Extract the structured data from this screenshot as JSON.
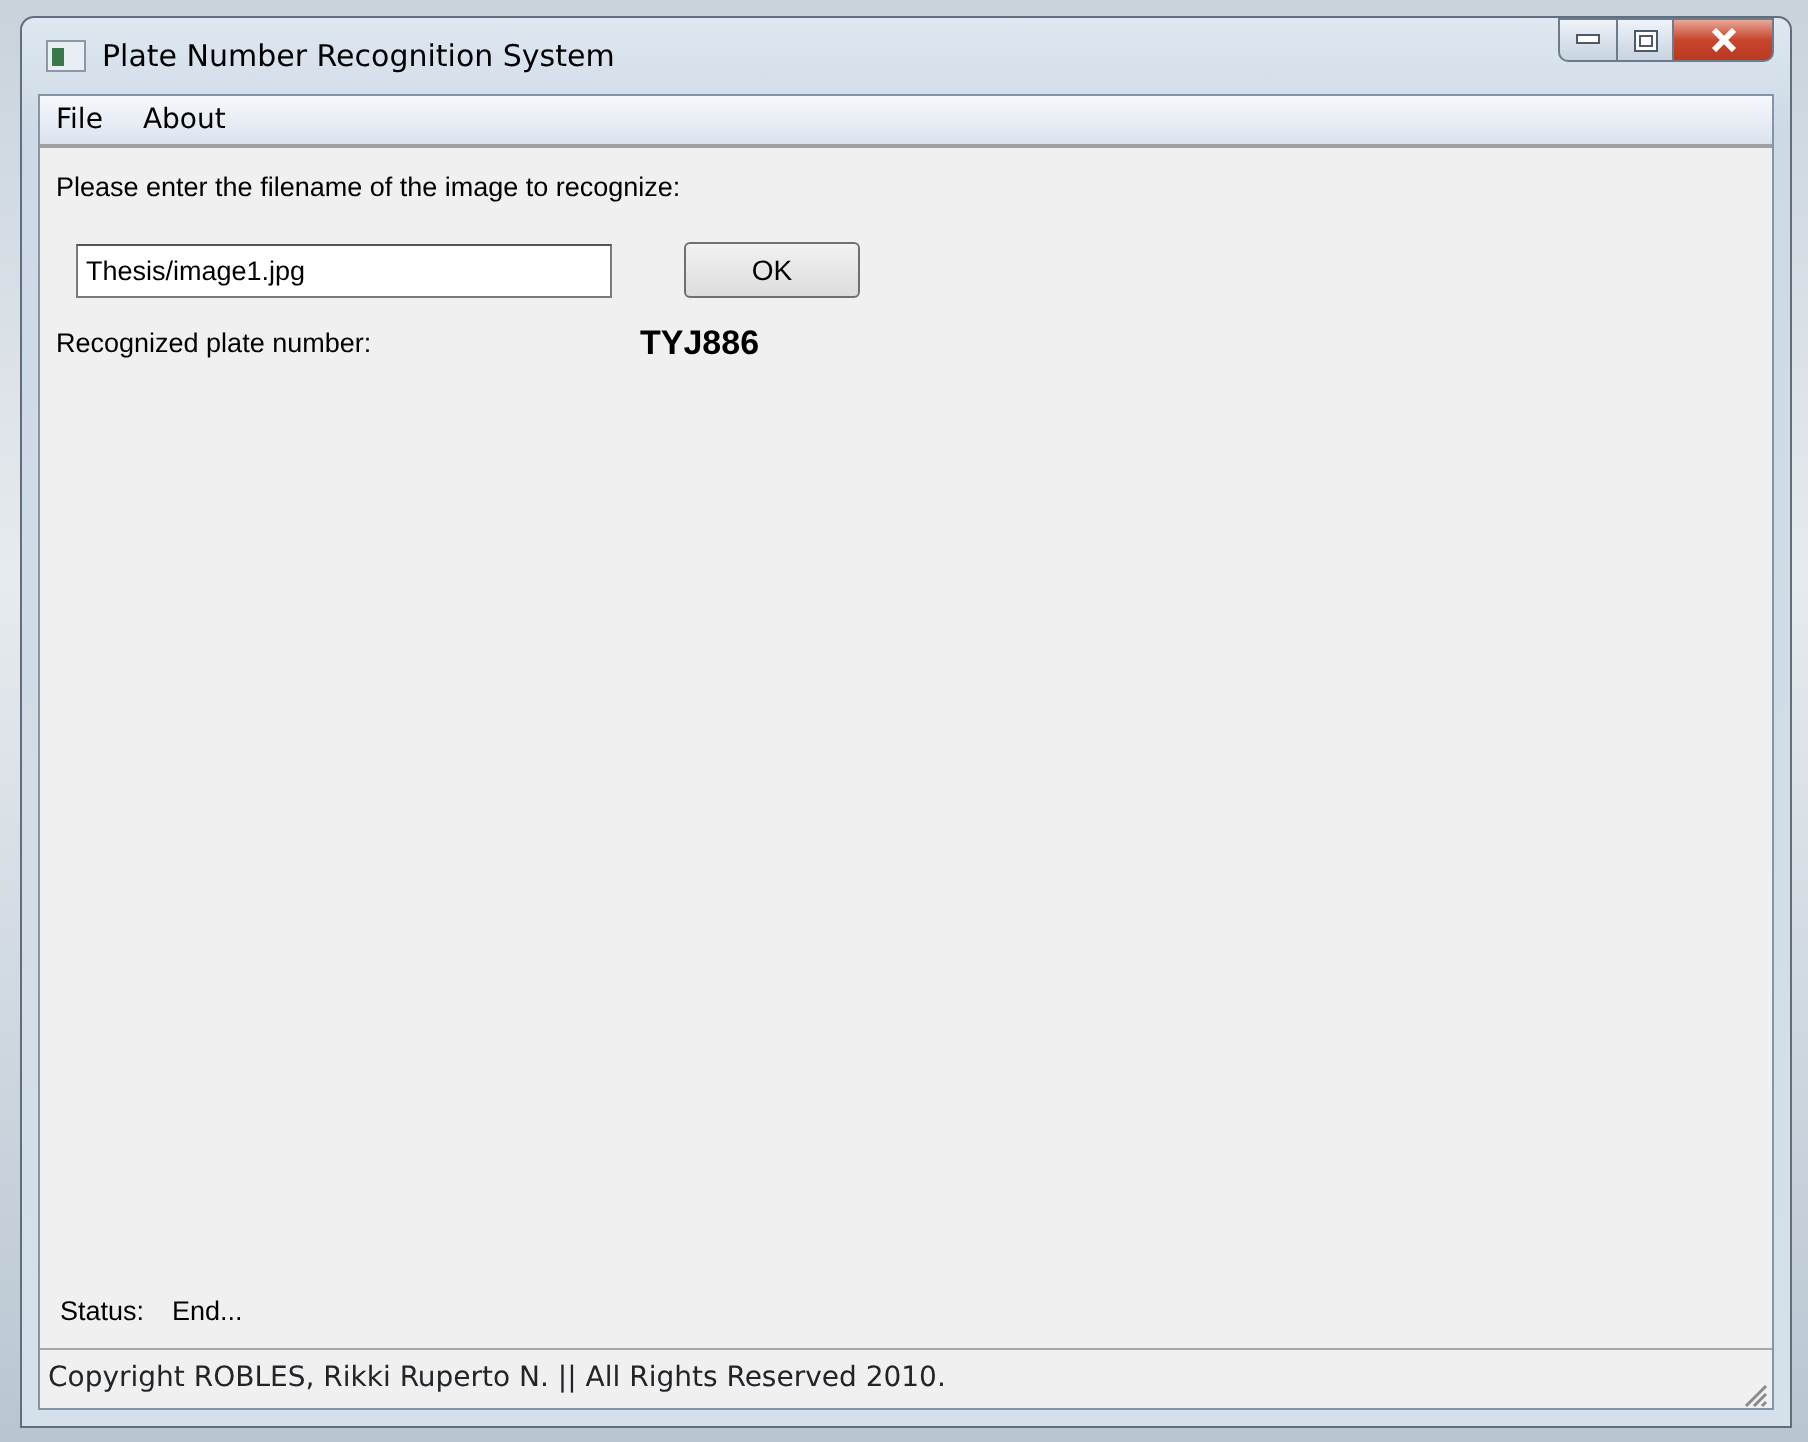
{
  "window": {
    "title": "Plate Number Recognition System"
  },
  "menu": [
    {
      "label": "File"
    },
    {
      "label": "About"
    }
  ],
  "prompt": "Please enter the filename of the image to recognize:",
  "filename_field": {
    "value": "Thesis/image1.jpg"
  },
  "ok_button": "OK",
  "result": {
    "label": "Recognized plate number:",
    "value": "TYJ886"
  },
  "status": {
    "label": "Status:",
    "value": "End..."
  },
  "status_bar": "Copyright ROBLES, Rikki Ruperto N.  ||  All Rights Reserved 2010."
}
